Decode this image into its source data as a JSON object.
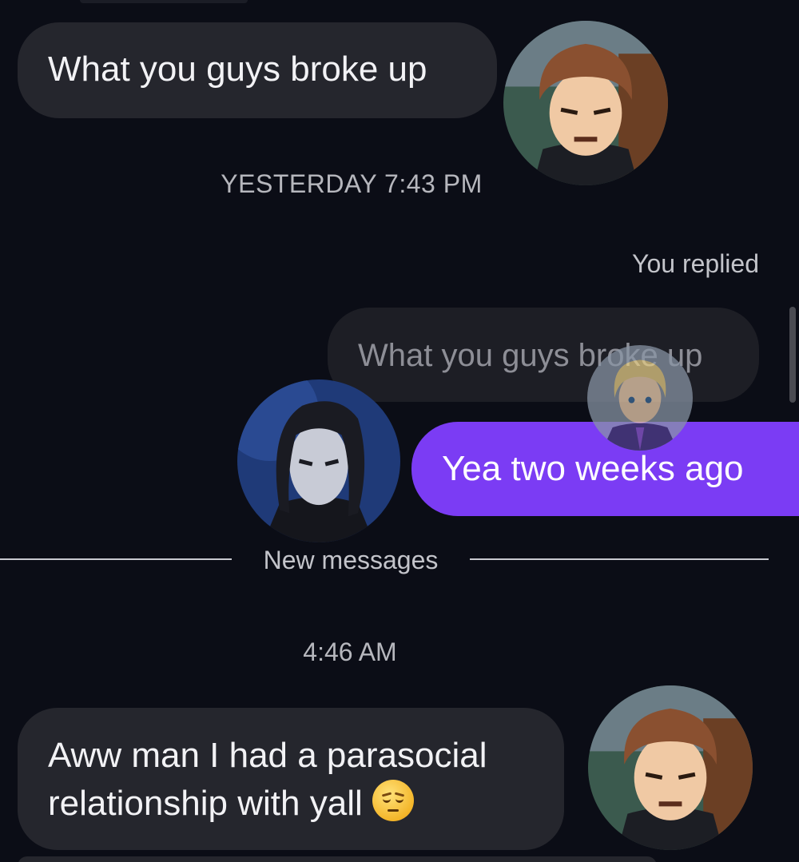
{
  "conversation": {
    "messages": [
      {
        "direction": "incoming",
        "text": "What you guys broke up",
        "sender_avatar": "jean-avatar"
      },
      {
        "direction": "outgoing",
        "text": "Yea two weeks ago",
        "reply_to": "What you guys broke up"
      },
      {
        "direction": "incoming",
        "lines": [
          "Aww man I had a parasocial",
          "relationship with yall"
        ],
        "emoji": "pensive-face-emoji",
        "sender_avatar": "jean-avatar"
      }
    ],
    "timestamp_1": "YESTERDAY 7:43 PM",
    "reply_label": "You replied",
    "quoted_text": "What you guys broke up",
    "sent_text": "Yea two weeks ago",
    "new_messages_label": "New messages",
    "timestamp_2": "4:46 AM",
    "msg1_text": "What you guys broke up",
    "msg2_line1": "Aww man I had a parasocial",
    "msg2_line2": "relationship with yall"
  },
  "colors": {
    "background": "#0b0d16",
    "incoming_bubble": "#25262d",
    "outgoing_bubble": "#7b3cf4",
    "quoted_bubble": "#1d1e25"
  },
  "icons": {
    "emoji": "pensive-face-emoji",
    "avatars": [
      "jean-avatar",
      "eren-avatar",
      "armin-read-receipt-avatar"
    ]
  }
}
